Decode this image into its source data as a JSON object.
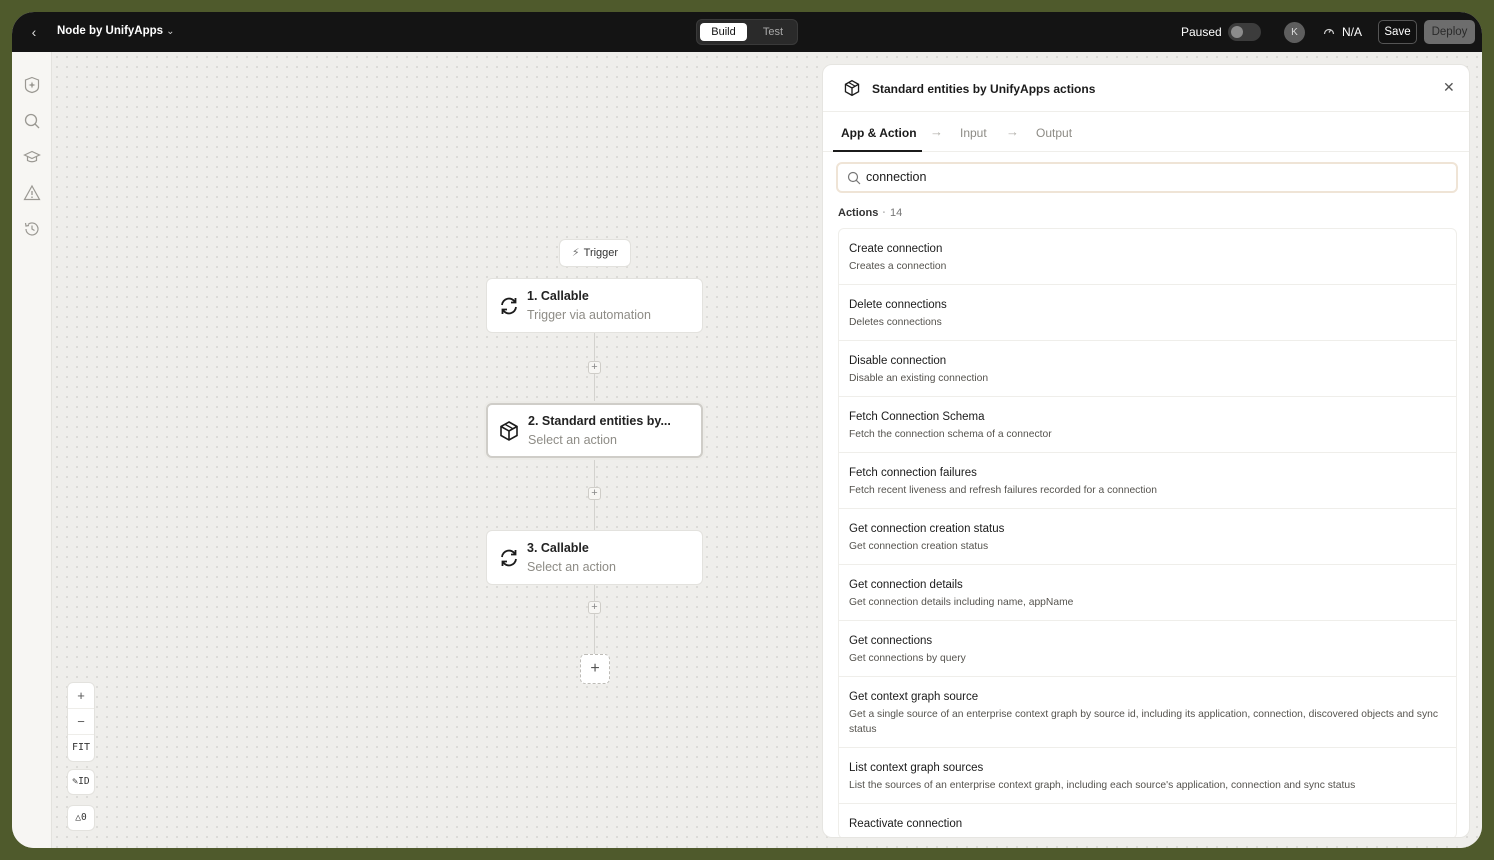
{
  "topbar": {
    "title": "Node by UnifyApps",
    "tabs": [
      "Build",
      "Test"
    ],
    "active_tab": "Build",
    "status_label": "Paused",
    "toggle_on": false,
    "avatar_initial": "K",
    "metric_value": "N/A",
    "save_label": "Save",
    "deploy_label": "Deploy"
  },
  "sidebar": {
    "icons": [
      "spark-badge-icon",
      "search-icon",
      "graduation-cap-icon",
      "warning-icon",
      "history-icon"
    ]
  },
  "canvas": {
    "trigger_label": "Trigger",
    "nodes": [
      {
        "title": "1. Callable",
        "subtitle": "Trigger via automation",
        "icon": "refresh-icon",
        "selected": false
      },
      {
        "title": "2. Standard entities by...",
        "subtitle": "Select an action",
        "icon": "package-icon",
        "selected": true
      },
      {
        "title": "3. Callable",
        "subtitle": "Select an action",
        "icon": "refresh-icon",
        "selected": false
      }
    ],
    "controls": {
      "zoom_in": "+",
      "zoom_out": "−",
      "fit": "FIT",
      "id_toggle": "ID",
      "warning_count": "0"
    }
  },
  "panel": {
    "title": "Standard entities by UnifyApps actions",
    "steps": [
      "App & Action",
      "Input",
      "Output"
    ],
    "active_step": "App & Action",
    "search_value": "connection",
    "actions_label": "Actions",
    "actions_count": "14",
    "actions": [
      {
        "title": "Create connection",
        "desc": "Creates a connection"
      },
      {
        "title": "Delete connections",
        "desc": "Deletes connections"
      },
      {
        "title": "Disable connection",
        "desc": "Disable an existing connection"
      },
      {
        "title": "Fetch Connection Schema",
        "desc": "Fetch the connection schema of a connector"
      },
      {
        "title": "Fetch connection failures",
        "desc": "Fetch recent liveness and refresh failures recorded for a connection"
      },
      {
        "title": "Get connection creation status",
        "desc": "Get connection creation status"
      },
      {
        "title": "Get connection details",
        "desc": "Get connection details including name, appName"
      },
      {
        "title": "Get connections",
        "desc": "Get connections by query"
      },
      {
        "title": "Get context graph source",
        "desc": "Get a single source of an enterprise context graph by source id, including its application, connection, discovered objects and sync status"
      },
      {
        "title": "List context graph sources",
        "desc": "List the sources of an enterprise context graph, including each source's application, connection and sync status"
      },
      {
        "title": "Reactivate connection",
        "desc": ""
      }
    ]
  }
}
